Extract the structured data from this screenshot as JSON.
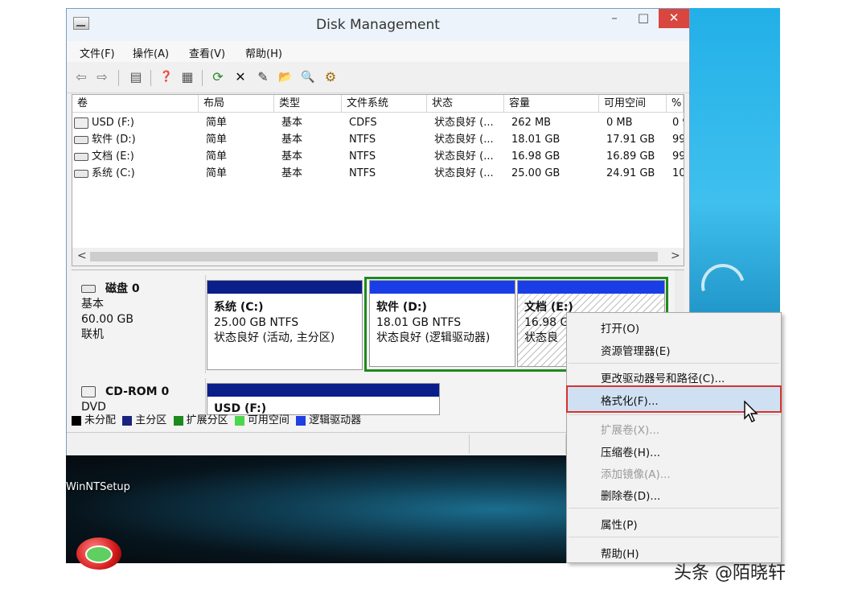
{
  "window": {
    "title": "Disk Management",
    "minimize_glyph": "–",
    "maximize_glyph": "□",
    "close_glyph": "✕"
  },
  "menu": [
    {
      "label": "文件(F)"
    },
    {
      "label": "操作(A)"
    },
    {
      "label": "查看(V)"
    },
    {
      "label": "帮助(H)"
    }
  ],
  "toolbar": [
    {
      "icon": "back-arrow-icon",
      "glyph": "⇦"
    },
    {
      "icon": "forward-arrow-icon",
      "glyph": "⇨"
    },
    {
      "icon": "console-tree-icon",
      "glyph": "▤"
    },
    {
      "icon": "help-book-icon",
      "glyph": "❓"
    },
    {
      "icon": "properties-panel-icon",
      "glyph": "▦"
    },
    {
      "icon": "refresh-icon",
      "glyph": "⟳"
    },
    {
      "icon": "delete-x-icon",
      "glyph": "✕"
    },
    {
      "icon": "check-properties-icon",
      "glyph": "✎"
    },
    {
      "icon": "open-folder-icon",
      "glyph": "📂"
    },
    {
      "icon": "search-magnifier-icon",
      "glyph": "🔍"
    },
    {
      "icon": "settings-grid-icon",
      "glyph": "⚙"
    }
  ],
  "volume_list": {
    "columns": [
      "卷",
      "布局",
      "类型",
      "文件系统",
      "状态",
      "容量",
      "可用空间",
      "%"
    ],
    "rows": [
      {
        "volume": "USD (F:)",
        "layout": "简单",
        "type": "基本",
        "fs": "CDFS",
        "status": "状态良好 (...",
        "capacity": "262 MB",
        "free": "0 MB",
        "pct": "0 9"
      },
      {
        "volume": "软件 (D:)",
        "layout": "简单",
        "type": "基本",
        "fs": "NTFS",
        "status": "状态良好 (...",
        "capacity": "18.01 GB",
        "free": "17.91 GB",
        "pct": "99"
      },
      {
        "volume": "文档 (E:)",
        "layout": "简单",
        "type": "基本",
        "fs": "NTFS",
        "status": "状态良好 (...",
        "capacity": "16.98 GB",
        "free": "16.89 GB",
        "pct": "99"
      },
      {
        "volume": "系统 (C:)",
        "layout": "简单",
        "type": "基本",
        "fs": "NTFS",
        "status": "状态良好 (...",
        "capacity": "25.00 GB",
        "free": "24.91 GB",
        "pct": "10("
      }
    ],
    "scroll_left": "<",
    "scroll_right": ">"
  },
  "disks": [
    {
      "name": "磁盘 0",
      "kind": "基本",
      "size": "60.00 GB",
      "state": "联机",
      "partitions": [
        {
          "name": "系统  (C:)",
          "size_fs": "25.00 GB NTFS",
          "status": "状态良好 (活动, 主分区)"
        },
        {
          "name": "软件  (D:)",
          "size_fs": "18.01 GB NTFS",
          "status": "状态良好 (逻辑驱动器)"
        },
        {
          "name": "文档  (E:)",
          "size_fs": "16.98 G",
          "status": "状态良"
        }
      ]
    },
    {
      "name": "CD-ROM 0",
      "kind": "DVD",
      "partitions": [
        {
          "name": "USD   (F:)"
        }
      ]
    }
  ],
  "legend": [
    {
      "label": "未分配",
      "color": "#000000"
    },
    {
      "label": "主分区",
      "color": "#1a237e"
    },
    {
      "label": "扩展分区",
      "color": "#1e8a1e"
    },
    {
      "label": "可用空间",
      "color": "#4cd64c"
    },
    {
      "label": "逻辑驱动器",
      "color": "#1f3fe0"
    }
  ],
  "context_menu": {
    "items": [
      {
        "label": "打开(O)",
        "enabled": true
      },
      {
        "label": "资源管理器(E)",
        "enabled": true
      },
      {
        "label": "更改驱动器号和路径(C)...",
        "enabled": true
      },
      {
        "label": "格式化(F)...",
        "enabled": true,
        "highlighted": true
      },
      {
        "label": "扩展卷(X)...",
        "enabled": false
      },
      {
        "label": "压缩卷(H)...",
        "enabled": true
      },
      {
        "label": "添加镜像(A)...",
        "enabled": false
      },
      {
        "label": "删除卷(D)...",
        "enabled": true
      },
      {
        "label": "属性(P)",
        "enabled": true
      },
      {
        "label": "帮助(H)",
        "enabled": true
      }
    ]
  },
  "desktop": {
    "icon_label": "WinNTSetup"
  },
  "watermark": "头条 @陌晓轩",
  "colors": {
    "primary_bar": "#0a1f8a",
    "logical_bar": "#1a3ee6",
    "extended_frame": "#1e8a1e",
    "highlight": "#cfe0f3",
    "highlight_outline": "#d8322f"
  }
}
